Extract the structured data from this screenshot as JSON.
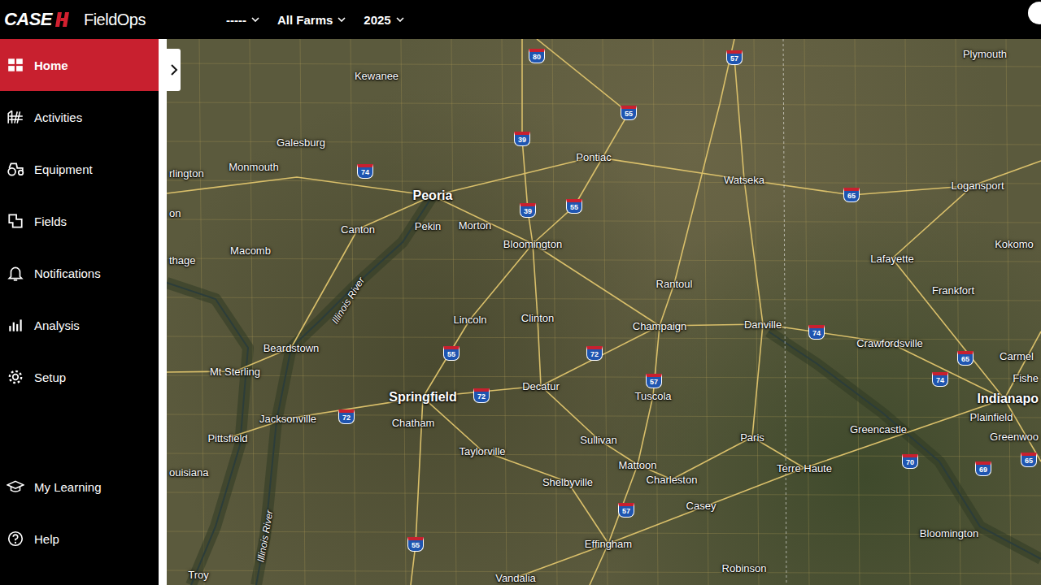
{
  "header": {
    "logo": "CASE",
    "product": "FieldOps",
    "filters": [
      {
        "label": "-----"
      },
      {
        "label": "All Farms"
      },
      {
        "label": "2025"
      }
    ]
  },
  "sidebar": {
    "items": [
      {
        "label": "Home",
        "selected": true
      },
      {
        "label": "Activities",
        "selected": false
      },
      {
        "label": "Equipment",
        "selected": false
      },
      {
        "label": "Fields",
        "selected": false
      },
      {
        "label": "Notifications",
        "selected": false
      },
      {
        "label": "Analysis",
        "selected": false
      },
      {
        "label": "Setup",
        "selected": false
      }
    ],
    "footer_items": [
      {
        "label": "My Learning",
        "selected": false
      },
      {
        "label": "Help",
        "selected": false
      }
    ]
  },
  "map": {
    "places": [
      {
        "label": "Kewanee",
        "kind": "town"
      },
      {
        "label": "Plymouth",
        "kind": "town"
      },
      {
        "label": "Galesburg",
        "kind": "town"
      },
      {
        "label": "Monmouth",
        "kind": "town"
      },
      {
        "label": "rlington",
        "kind": "town"
      },
      {
        "label": "on",
        "kind": "town"
      },
      {
        "label": "Peoria",
        "kind": "city"
      },
      {
        "label": "Pontiac",
        "kind": "town"
      },
      {
        "label": "Watseka",
        "kind": "town"
      },
      {
        "label": "Logansport",
        "kind": "town"
      },
      {
        "label": "Canton",
        "kind": "town"
      },
      {
        "label": "Pekin",
        "kind": "town"
      },
      {
        "label": "Morton",
        "kind": "town"
      },
      {
        "label": "Bloomington",
        "kind": "town"
      },
      {
        "label": "Macomb",
        "kind": "town"
      },
      {
        "label": "thage",
        "kind": "town"
      },
      {
        "label": "Kokomo",
        "kind": "town"
      },
      {
        "label": "Lafayette",
        "kind": "town"
      },
      {
        "label": "Rantoul",
        "kind": "town"
      },
      {
        "label": "Frankfort",
        "kind": "town"
      },
      {
        "label": "Illinois River",
        "kind": "river"
      },
      {
        "label": "Lincoln",
        "kind": "town"
      },
      {
        "label": "Clinton",
        "kind": "town"
      },
      {
        "label": "Champaign",
        "kind": "town"
      },
      {
        "label": "Danville",
        "kind": "town"
      },
      {
        "label": "Crawfordsville",
        "kind": "town"
      },
      {
        "label": "Beardstown",
        "kind": "town"
      },
      {
        "label": "Carmel",
        "kind": "town"
      },
      {
        "label": "Mt Sterling",
        "kind": "town"
      },
      {
        "label": "Fishe",
        "kind": "town"
      },
      {
        "label": "Springfield",
        "kind": "city"
      },
      {
        "label": "Decatur",
        "kind": "town"
      },
      {
        "label": "Tuscola",
        "kind": "town"
      },
      {
        "label": "Indianapo",
        "kind": "city"
      },
      {
        "label": "Plainfield",
        "kind": "town"
      },
      {
        "label": "Jacksonville",
        "kind": "town"
      },
      {
        "label": "Chatham",
        "kind": "town"
      },
      {
        "label": "Greencastle",
        "kind": "town"
      },
      {
        "label": "Greenwoo",
        "kind": "town"
      },
      {
        "label": "Pittsfield",
        "kind": "town"
      },
      {
        "label": "Paris",
        "kind": "town"
      },
      {
        "label": "Sullivan",
        "kind": "town"
      },
      {
        "label": "Taylorville",
        "kind": "town"
      },
      {
        "label": "Mattoon",
        "kind": "town"
      },
      {
        "label": "Terre Haute",
        "kind": "town"
      },
      {
        "label": "ouisiana",
        "kind": "town"
      },
      {
        "label": "Charleston",
        "kind": "town"
      },
      {
        "label": "Shelbyville",
        "kind": "town"
      },
      {
        "label": "Illinois River",
        "kind": "river"
      },
      {
        "label": "Casey",
        "kind": "town"
      },
      {
        "label": "Bloomington",
        "kind": "town"
      },
      {
        "label": "Effingham",
        "kind": "town"
      },
      {
        "label": "Robinson",
        "kind": "town"
      },
      {
        "label": "Troy",
        "kind": "town"
      },
      {
        "label": "Vandalia",
        "kind": "town"
      }
    ],
    "highways": [
      {
        "label": "80"
      },
      {
        "label": "57"
      },
      {
        "label": "55"
      },
      {
        "label": "39"
      },
      {
        "label": "74"
      },
      {
        "label": "39"
      },
      {
        "label": "55"
      },
      {
        "label": "65"
      },
      {
        "label": "74"
      },
      {
        "label": "72"
      },
      {
        "label": "55"
      },
      {
        "label": "65"
      },
      {
        "label": "57"
      },
      {
        "label": "72"
      },
      {
        "label": "74"
      },
      {
        "label": "72"
      },
      {
        "label": "70"
      },
      {
        "label": "69"
      },
      {
        "label": "65"
      },
      {
        "label": "57"
      },
      {
        "label": "55"
      }
    ]
  }
}
